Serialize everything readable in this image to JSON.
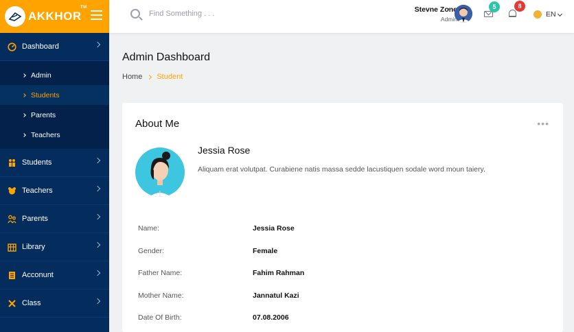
{
  "brand": {
    "name": "AKKHOR",
    "tm": "TM"
  },
  "search": {
    "placeholder": "Find Something . . ."
  },
  "user": {
    "name": "Stevne Zone",
    "role": "Admin"
  },
  "notifications": {
    "messages_count": "5",
    "alerts_count": "8"
  },
  "language": {
    "selected": "EN"
  },
  "sidebar": {
    "items": [
      {
        "label": "Dashboard",
        "icon": "dashboard-icon"
      },
      {
        "label": "Students",
        "icon": "students-icon"
      },
      {
        "label": "Teachers",
        "icon": "teachers-icon"
      },
      {
        "label": "Parents",
        "icon": "parents-icon"
      },
      {
        "label": "Library",
        "icon": "library-icon"
      },
      {
        "label": "Acconunt",
        "icon": "account-icon"
      },
      {
        "label": "Class",
        "icon": "class-icon"
      }
    ],
    "submenu": [
      {
        "label": "Admin"
      },
      {
        "label": "Students"
      },
      {
        "label": "Parents"
      },
      {
        "label": "Teachers"
      }
    ]
  },
  "page": {
    "title": "Admin Dashboard",
    "breadcrumb": {
      "home": "Home",
      "current": "Student"
    }
  },
  "card": {
    "title": "About Me",
    "menu": "•••",
    "profile": {
      "name": "Jessia Rose",
      "bio": "Aliquam erat volutpat. Curabiene natis massa sedde lacustiquen sodale word moun taiery."
    },
    "rows": [
      {
        "label": "Name:",
        "value": "Jessia Rose"
      },
      {
        "label": "Gender:",
        "value": "Female"
      },
      {
        "label": "Father Name:",
        "value": "Fahim Rahman"
      },
      {
        "label": "Mother Name:",
        "value": "Jannatul Kazi"
      },
      {
        "label": "Date Of Birth:",
        "value": "07.08.2006"
      }
    ]
  },
  "colors": {
    "accent": "#ffa300",
    "sidebar": "#042c5c",
    "submenu": "#03214a"
  }
}
